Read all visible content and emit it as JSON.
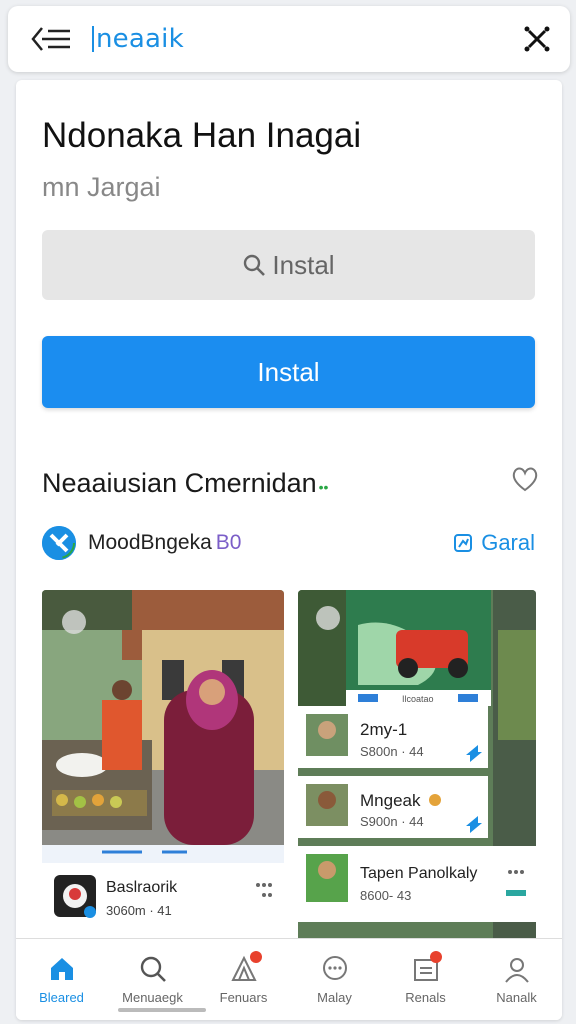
{
  "header": {
    "brand": "neaaik",
    "back_icon": "back-menu-icon",
    "close_icon": "close-icon"
  },
  "app": {
    "title": "Ndonaka Han Inagai",
    "subtitle": "mn Jargai",
    "search_placeholder": "Instal",
    "install_label": "Instal"
  },
  "section": {
    "title": "Neaaiusian Cmernidan",
    "title_suffix": "••",
    "favorite_icon": "heart-icon"
  },
  "developer": {
    "name": "MoodBngeka",
    "badge": "B0",
    "action_label": "Garal",
    "action_icon": "share-icon"
  },
  "left_screenshot": {
    "card_name": "Baslraorik",
    "card_meta": "3060m · 41"
  },
  "right_screenshot": {
    "tabs": [
      "Ilcoatao"
    ],
    "list": [
      {
        "name": "2my-1",
        "meta": "S800n · 44"
      },
      {
        "name": "Mngeak",
        "meta": "S900n · 44"
      },
      {
        "name": "Tapen Panolkaly",
        "meta": "8600- 43"
      }
    ]
  },
  "bottom_nav": [
    {
      "label": "Bleared",
      "icon": "home-icon",
      "active": true,
      "badge": false
    },
    {
      "label": "Menuaegk",
      "icon": "search-icon",
      "active": false,
      "badge": false
    },
    {
      "label": "Fenuars",
      "icon": "apps-icon",
      "active": false,
      "badge": true
    },
    {
      "label": "Malay",
      "icon": "chat-icon",
      "active": false,
      "badge": false
    },
    {
      "label": "Renals",
      "icon": "inbox-icon",
      "active": false,
      "badge": true
    },
    {
      "label": "Nanalk",
      "icon": "profile-icon",
      "active": false,
      "badge": false
    }
  ],
  "colors": {
    "accent": "#1a8fe3",
    "install": "#1b8df0",
    "badge": "#e8412d"
  }
}
